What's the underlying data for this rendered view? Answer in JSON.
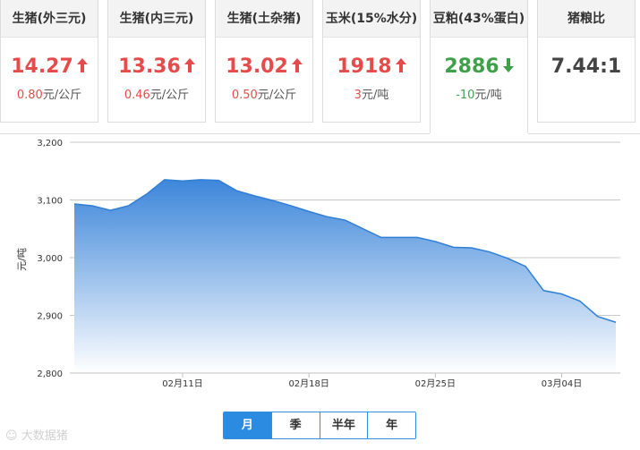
{
  "cards": [
    {
      "title": "生猪(外三元)",
      "price": "14.27",
      "direction": "up",
      "change_value": "0.80",
      "change_unit": "元/公斤"
    },
    {
      "title": "生猪(内三元)",
      "price": "13.36",
      "direction": "up",
      "change_value": "0.46",
      "change_unit": "元/公斤"
    },
    {
      "title": "生猪(土杂猪)",
      "price": "13.02",
      "direction": "up",
      "change_value": "0.50",
      "change_unit": "元/公斤"
    },
    {
      "title": "玉米(15%水分)",
      "price": "1918",
      "direction": "up",
      "change_value": "3",
      "change_unit": "元/吨"
    },
    {
      "title": "豆粕(43%蛋白)",
      "price": "2886",
      "direction": "down",
      "change_value": "-10",
      "change_unit": "元/吨"
    },
    {
      "title": "猪粮比",
      "price": "7.44:1",
      "direction": "flat",
      "change_value": "",
      "change_unit": ""
    }
  ],
  "colors": {
    "up": "#e64b4b",
    "down": "#3fa04a",
    "line": "#2f7fd6",
    "fill_top": "#3380d8",
    "fill_bottom": "#ffffff",
    "tab_active": "#2b8be0"
  },
  "icons": {
    "up": "arrow-up-icon",
    "down": "arrow-down-icon"
  },
  "range_tabs": [
    {
      "label": "月",
      "selected": true
    },
    {
      "label": "季",
      "selected": false
    },
    {
      "label": "半年",
      "selected": false
    },
    {
      "label": "年",
      "selected": false
    }
  ],
  "watermark": "大数据猪",
  "chart_data": {
    "type": "area",
    "title": "",
    "xlabel": "",
    "ylabel": "元/吨",
    "ylim": [
      2800,
      3200
    ],
    "yticks": [
      2800,
      2900,
      3000,
      3100,
      3200
    ],
    "ytick_labels": [
      "2,800",
      "2,900",
      "3,000",
      "3,100",
      "3,200"
    ],
    "xtick_labels": [
      {
        "index": 6,
        "label": "02月11日"
      },
      {
        "index": 13,
        "label": "02月18日"
      },
      {
        "index": 20,
        "label": "02月25日"
      },
      {
        "index": 27,
        "label": "03月04日"
      }
    ],
    "grid": true,
    "legend": "none",
    "series": [
      {
        "values": [
          3093,
          3090,
          3082,
          3090,
          3110,
          3135,
          3133,
          3135,
          3134,
          3116,
          3107,
          3099,
          3090,
          3080,
          3071,
          3065,
          3050,
          3035,
          3035,
          3035,
          3028,
          3018,
          3017,
          3010,
          2999,
          2985,
          2943,
          2937,
          2925,
          2898,
          2888
        ]
      }
    ]
  }
}
